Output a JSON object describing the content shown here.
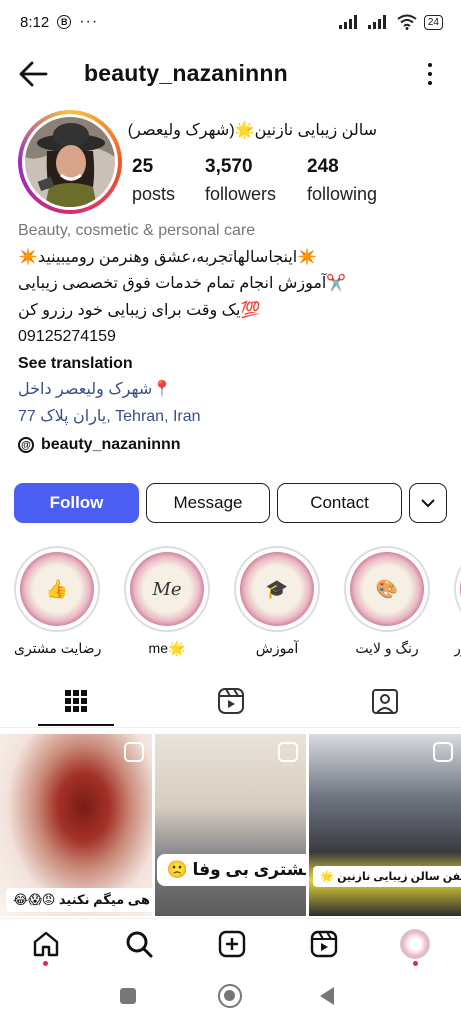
{
  "status": {
    "time": "8:12",
    "battery": "24"
  },
  "header": {
    "username": "beauty_nazaninnn"
  },
  "profile": {
    "full_name": "سالن زیبایی نازنین🌟(شهرک ولیعصر)",
    "stats": [
      {
        "value": "25",
        "label": "posts"
      },
      {
        "value": "3,570",
        "label": "followers"
      },
      {
        "value": "248",
        "label": "following"
      }
    ],
    "category": "Beauty, cosmetic & personal care",
    "bio_lines": [
      "✴️اینجاسالهاتجربه،عشق وهنرمن رومیبینید✴️",
      "✂️آموزش انجام تمام خدمات فوق تخصصی زیبایی",
      "💯یک وقت برای زیبایی خود رزرو کن",
      "09125274159"
    ],
    "see_translation": "See translation",
    "location_line1": "📍شهرک ولیعصر داخل",
    "location_line2_prefix": "یاران پلاک 77",
    "location_line2_city": "Tehran, Iran",
    "threads_handle": "beauty_nazaninnn"
  },
  "actions": {
    "follow": "Follow",
    "message": "Message",
    "contact": "Contact"
  },
  "highlights": [
    {
      "label": "رضایت مشتری",
      "glyph": "👍"
    },
    {
      "label": "me🌟",
      "glyph": "Me"
    },
    {
      "label": "آموزش",
      "glyph": "🎓"
    },
    {
      "label": "رنگ و لایت",
      "glyph": "🎨"
    },
    {
      "label": "تور",
      "glyph": ""
    }
  ],
  "posts": [
    {
      "caption": "هی میگم نکنید 😡😱😂"
    },
    {
      "caption": "مشتری بی وفا 🙁"
    },
    {
      "caption": "پرسنل خفن سالن زیبایی نازنین 🌟"
    }
  ],
  "colors": {
    "accent": "#4a5ff2",
    "notification": "#e0245e"
  }
}
